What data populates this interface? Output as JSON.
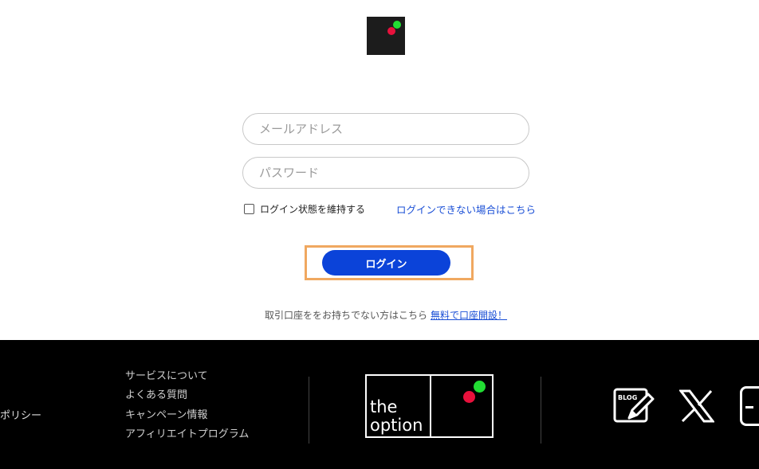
{
  "colors": {
    "brand_green": "#22dd33",
    "brand_red": "#e8113c",
    "primary_blue": "#0b43d9",
    "highlight_orange": "#f0a860"
  },
  "login": {
    "email_placeholder": "メールアドレス",
    "password_placeholder": "パスワード",
    "remember_label": "ログイン状態を維持する",
    "forgot_link": "ログインできない場合はこちら",
    "login_button": "ログイン",
    "signup_text": "取引口座ををお持ちでない方はこちら",
    "signup_link": "無料で口座開設！"
  },
  "footer": {
    "policy_fragment": "ポリシー",
    "links": [
      "サービスについて",
      "よくある質問",
      "キャンペーン情報",
      "アフィリエイトプログラム"
    ],
    "brand_line1": "the",
    "brand_line2": "option",
    "blog_icon_label": "BLOG",
    "social_icons": [
      "blog-icon",
      "x-icon",
      "partial-icon"
    ]
  }
}
